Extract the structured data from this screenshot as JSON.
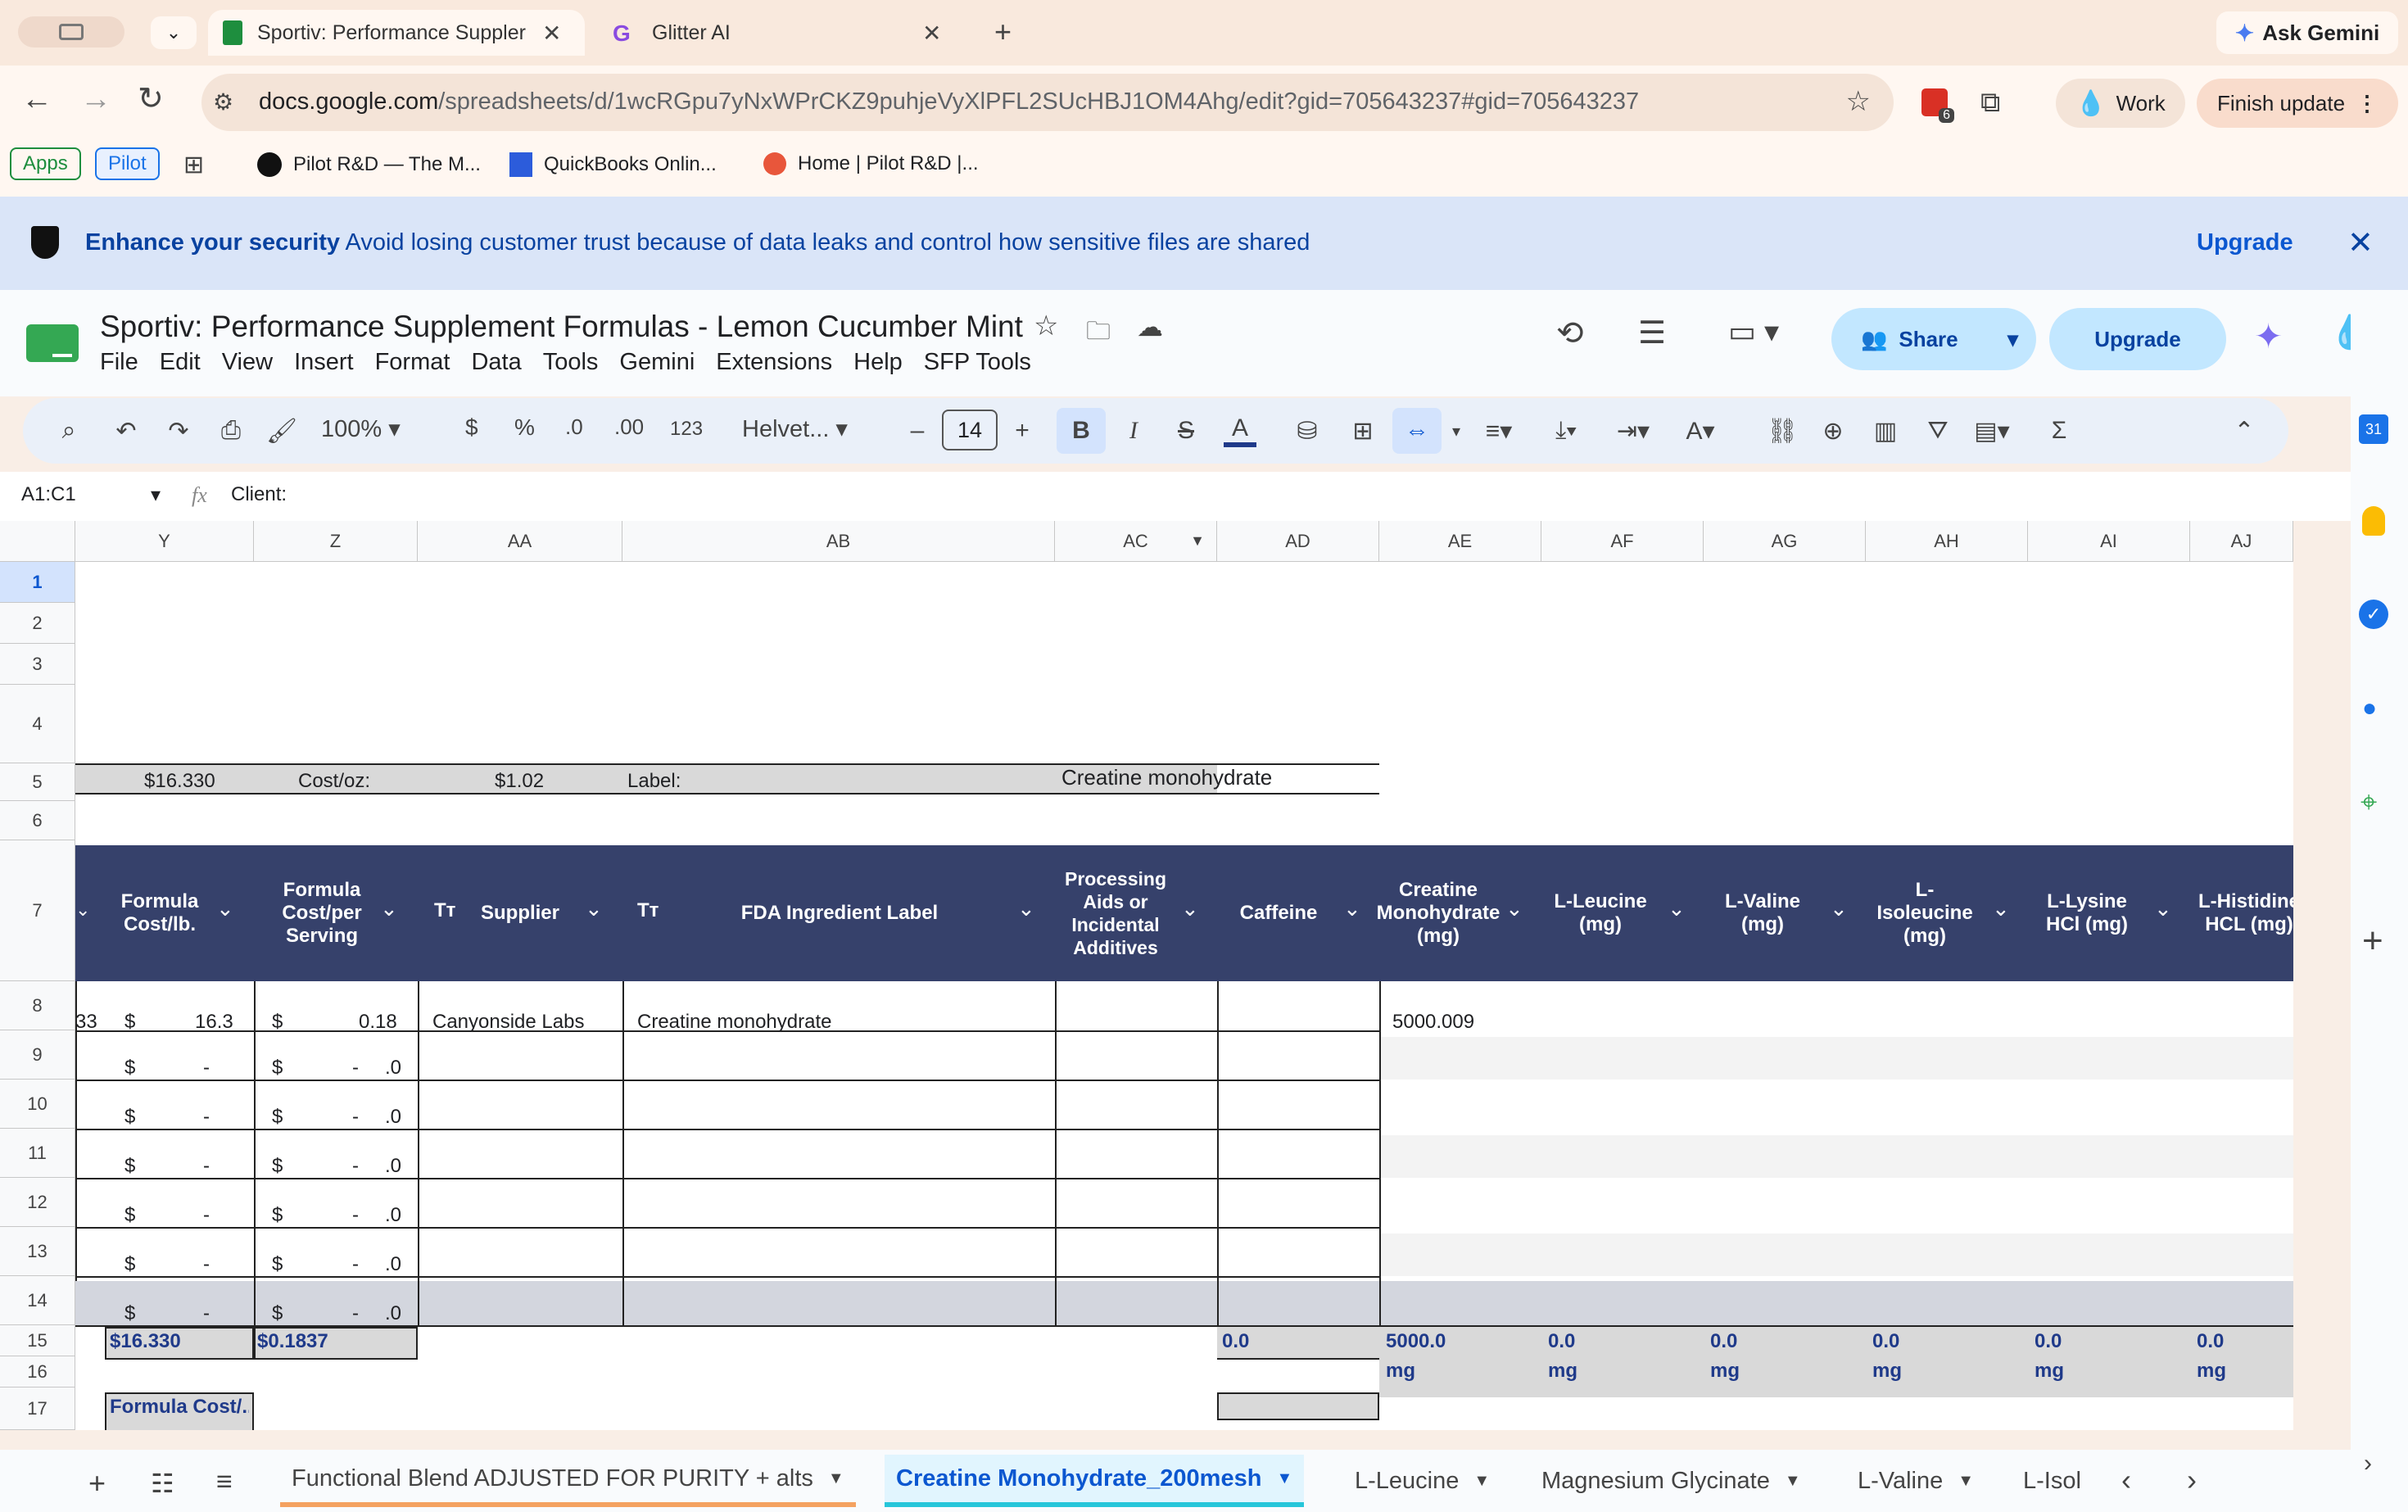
{
  "browser": {
    "tabs": [
      {
        "label": "Sportiv: Performance Suppler",
        "active": true
      },
      {
        "label": "Glitter AI",
        "active": false
      }
    ],
    "ask_gemini": "Ask Gemini",
    "url_prefix": "docs.google.com",
    "url_rest": "/spreadsheets/d/1wcRGpu7yNxWPrCKZ9puhjeVyXlPFL2SUcHBJ1OM4Ahg/edit?gid=705643237#gid=705643237",
    "extension_badge": "6",
    "profile_label": "Work",
    "finish_update": "Finish update",
    "bookmarks": [
      "Apps",
      "Pilot",
      "Pilot R&D — The M...",
      "QuickBooks Onlin...",
      "Home | Pilot R&D |..."
    ]
  },
  "banner": {
    "bold": "Enhance your security",
    "text": "Avoid losing customer trust because of data leaks and control how sensitive files are shared",
    "action": "Upgrade"
  },
  "doc": {
    "title": "Sportiv: Performance Supplement Formulas - Lemon Cucumber Mint",
    "menu": [
      "File",
      "Edit",
      "View",
      "Insert",
      "Format",
      "Data",
      "Tools",
      "Gemini",
      "Extensions",
      "Help",
      "SFP Tools"
    ],
    "share": "Share",
    "upgrade": "Upgrade"
  },
  "toolbar": {
    "zoom": "100%",
    "currency": "$",
    "percent": "%",
    "dec_less": ".0",
    "dec_more": ".00",
    "format_123": "123",
    "font": "Helvet...",
    "font_size": "14"
  },
  "formula_bar": {
    "name_box": "A1:C1",
    "fx": "fx",
    "content": "Client:"
  },
  "grid": {
    "columns": [
      "Y",
      "Z",
      "AA",
      "AB",
      "AC",
      "AD",
      "AE",
      "AF",
      "AG",
      "AH",
      "AI",
      "AJ"
    ],
    "rows": [
      "1",
      "2",
      "3",
      "4",
      "5",
      "6",
      "7",
      "8",
      "9",
      "10",
      "11",
      "12",
      "13",
      "14",
      "15",
      "16",
      "17"
    ],
    "row5": {
      "y": "$16.330",
      "z": "Cost/oz:",
      "aa": "$1.02",
      "ab": "Label:",
      "ac": "Creatine monohydrate"
    },
    "headers": {
      "y": "Formula Cost/lb.",
      "z": "Formula Cost/per Serving",
      "aa": "Supplier",
      "ab": "FDA Ingredient Label",
      "ac": "Processing Aids or Incidental Additives",
      "ad": "Caffeine",
      "ae": "Creatine Monohydrate (mg)",
      "af": "L-Leucine (mg)",
      "ag": "L-Valine (mg)",
      "ah": "L-Isoleucine (mg)",
      "ai": "L-Lysine HCl (mg)",
      "aj": "L-Histidine HCL (mg)",
      "tt": "Tт"
    },
    "row8": {
      "x_partial": "33",
      "y_cur": "$",
      "y_val": "16.3",
      "z_cur": "$",
      "z_val": "0.18",
      "aa": "Canyonside Labs",
      "ab": "Creatine monohydrate",
      "ae": "5000.009"
    },
    "empty_rows": {
      "cur": "$",
      "dash": "-",
      "z_dash": "-",
      "z_dec": ".0"
    },
    "row15": {
      "y": "$16.330",
      "z": "$0.1837",
      "ad": "0.0",
      "ae": "5000.0",
      "af": "0.0",
      "ag": "0.0",
      "ah": "0.0",
      "ai": "0.0",
      "aj": "0.0"
    },
    "row16_unit": "mg",
    "row17": "Formula Cost/..."
  },
  "sheet_tabs": [
    "Functional Blend ADJUSTED FOR PURITY + alts",
    "Creatine Monohydrate_200mesh",
    "L-Leucine",
    "Magnesium Glycinate",
    "L-Valine",
    "L-Isol"
  ],
  "colors": {
    "header_navy": "#36416b",
    "accent_blue": "#0b57d0",
    "share_bg": "#c2e7ff",
    "banner_bg": "#dae5f8"
  }
}
